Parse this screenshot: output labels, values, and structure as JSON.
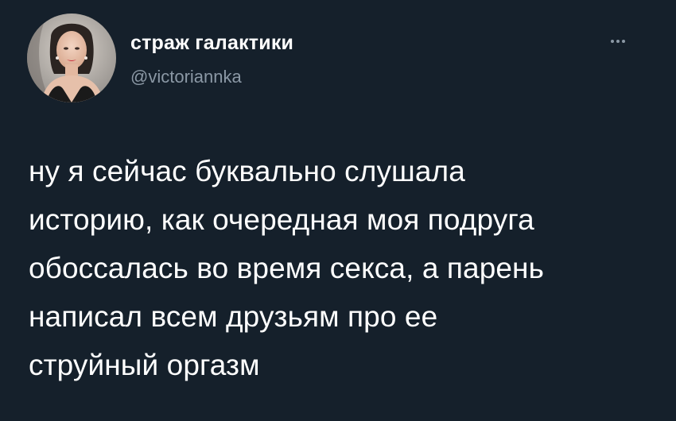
{
  "author": {
    "display_name": "страж галактики",
    "handle": "@victoriannka",
    "avatar_icon": "avatar-photo"
  },
  "menu": {
    "more_icon": "more-options-icon"
  },
  "tweet": {
    "lines": [
      "ну я сейчас буквально слушала",
      "историю, как очередная моя подруга",
      "обоссалась во время секса, а парень",
      "написал всем друзьям про ее",
      "струйный оргазм"
    ]
  },
  "colors": {
    "background": "#15202b",
    "text": "#ffffff",
    "secondary": "#8b98a5"
  }
}
